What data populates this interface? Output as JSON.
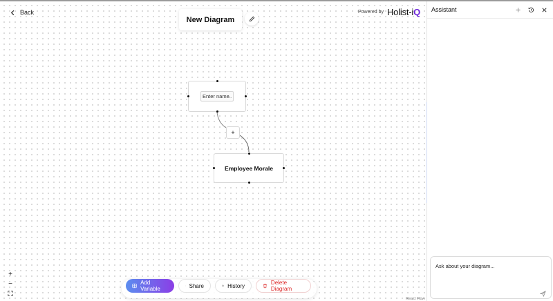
{
  "header": {
    "back_label": "Back",
    "diagram_title": "New Diagram",
    "powered_by": "Powered by",
    "brand_main": "Holist-i",
    "brand_accent": "Q"
  },
  "nodes": {
    "new_node_placeholder": "Enter name...",
    "existing_node_label": "Employee Morale",
    "add_connection_label": "+"
  },
  "toolbar": {
    "add_variable": "Add Variable",
    "share": "Share",
    "history": "History",
    "delete_diagram": "Delete Diagram"
  },
  "zoom": {
    "zoom_in": "+",
    "zoom_out": "−"
  },
  "footer": {
    "attribution": "React Flow"
  },
  "assistant": {
    "title": "Assistant",
    "input_placeholder": "Ask about your diagram..."
  },
  "colors": {
    "brand_accent": "#6d28d9",
    "add_gradient_start": "#5b8def",
    "add_gradient_end": "#8b3ee6",
    "delete_red": "#dc2626"
  },
  "icons": [
    "chevron-left-icon",
    "pencil-icon",
    "plus-icon",
    "history-icon",
    "close-icon",
    "send-icon",
    "fit-view-icon",
    "grid-plus-icon",
    "share-icon",
    "trash-icon"
  ]
}
